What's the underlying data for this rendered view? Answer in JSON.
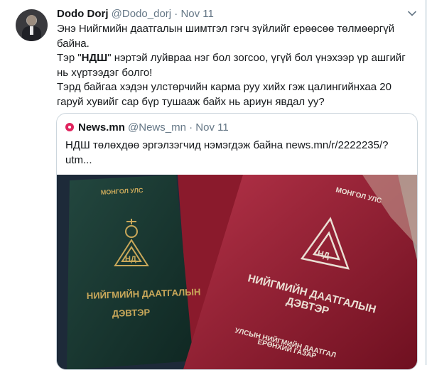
{
  "author": {
    "name": "Dodo Dorj",
    "handle": "@Dodo_dorj",
    "separator": "·",
    "date": "Nov 11"
  },
  "tweet_text": {
    "line1": "Энэ Нийгмийн даатгалын шимтгэл гэгч зүйлийг ерөөсөө төлмөөргүй байна.",
    "line2_pre": "Тэр \"",
    "line2_bold": "НДШ",
    "line2_post": "\" нэртэй луйвраа нэг бол зогсоо, үгүй бол үнэхээр үр ашгийг нь хүртээдэг болго!",
    "line3": "Тэрд байгаа хэдэн улстөрчийн карма руу хийх гэж цалингийнхаа 20 гаруй хувийг сар бүр тушааж байх нь ариун явдал уу?"
  },
  "quoted": {
    "source_name": "News.mn",
    "source_handle": "@News_mn",
    "separator": "·",
    "date": "Nov 11",
    "text": "НДШ төлөхдөө эргэлзэгчид нэмэгдэж байна news.mn/r/2222235/?utm...",
    "image": {
      "booklet_left": {
        "country": "МОНГОЛ УЛС",
        "logo": "НД",
        "title_line1": "НИЙГМИЙН ДААТГАЛЫН",
        "title_line2": "ДЭВТЭР"
      },
      "booklet_right": {
        "country": "МОНГОЛ УЛС",
        "logo": "НД",
        "title_line1": "НИЙГМИЙН ДААТГАЛЫН",
        "title_line2": "ДЭВТЭР",
        "issuer_line1": "УЛСЫН НИЙГМИЙН ДААТГАЛ",
        "issuer_line2": "ЕРӨНХИЙ ГАЗАР"
      },
      "colors": {
        "green": "#1c3b34",
        "maroon": "#7d1626",
        "red": "#a3253a",
        "gold": "#c9a85a",
        "white_text": "#eadfd4"
      }
    }
  }
}
